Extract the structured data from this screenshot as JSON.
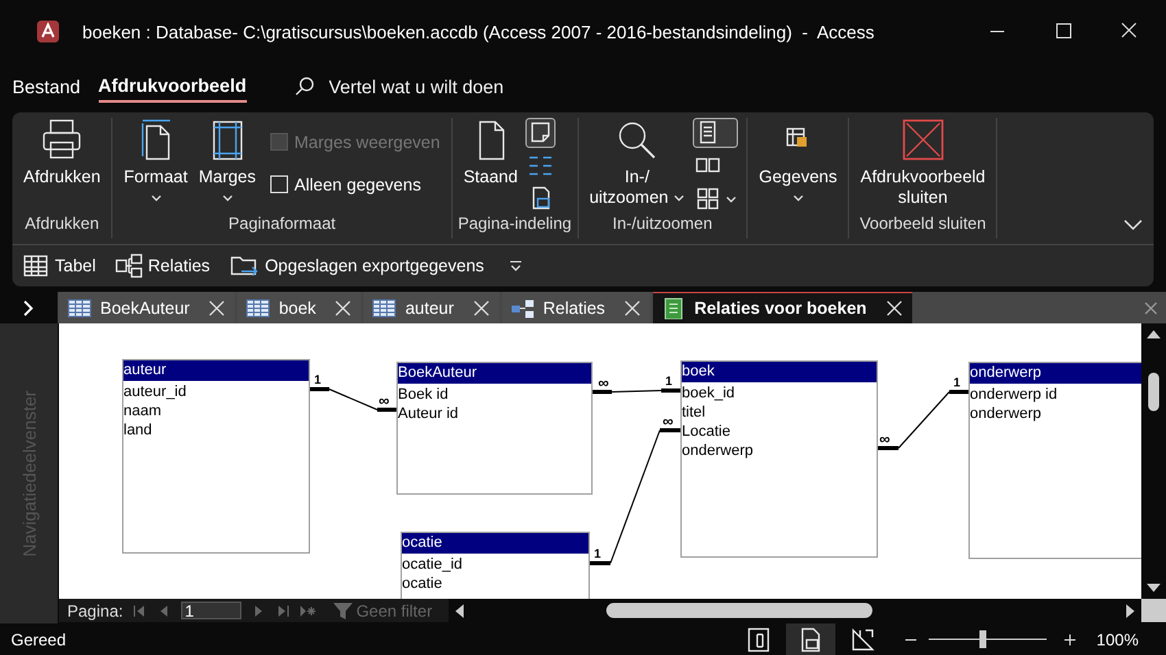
{
  "window": {
    "title": "boeken : Database- C:\\gratiscursus\\boeken.accdb (Access 2007 - 2016-bestandsindeling)  -  Access"
  },
  "menu": [
    {
      "label": "Bestand",
      "selected": false
    },
    {
      "label": "Afdrukvoorbeeld",
      "selected": true
    }
  ],
  "tell_me": {
    "placeholder": "Vertel wat u wilt doen"
  },
  "ribbon": {
    "groups": [
      {
        "label": "Afdrukken",
        "items": [
          {
            "kind": "large",
            "label": [
              "Afdrukken"
            ],
            "dropdown": false
          }
        ]
      },
      {
        "label": "Paginaformaat",
        "items": [
          {
            "kind": "large",
            "label": [
              "Formaat"
            ],
            "dropdown": true
          },
          {
            "kind": "large",
            "label": [
              "Marges"
            ],
            "dropdown": true
          },
          {
            "kind": "checkbox",
            "label": "Marges weergeven",
            "checked": false,
            "disabled": true
          },
          {
            "kind": "checkbox",
            "label": "Alleen gegevens",
            "checked": false,
            "disabled": false
          }
        ]
      },
      {
        "label": "Pagina-indeling",
        "items": [
          {
            "kind": "large",
            "label": [
              "Staand"
            ],
            "dropdown": false
          },
          {
            "kind": "icon",
            "selected": true,
            "dropdown": false
          },
          {
            "kind": "icon",
            "selected": false,
            "dropdown": false
          },
          {
            "kind": "icon",
            "selected": false,
            "dropdown": false
          }
        ]
      },
      {
        "label": "In-/uitzoomen",
        "items": [
          {
            "kind": "large",
            "label": [
              "In-/",
              "uitzoomen"
            ],
            "dropdown": true
          },
          {
            "kind": "icon",
            "selected": true,
            "dropdown": false
          },
          {
            "kind": "icon",
            "selected": false,
            "dropdown": false
          },
          {
            "kind": "icon",
            "selected": false,
            "dropdown": true
          }
        ]
      },
      {
        "items": [
          {
            "kind": "large",
            "label": [
              "Gegevens"
            ],
            "dropdown": true
          }
        ]
      },
      {
        "label": "Voorbeeld sluiten",
        "items": [
          {
            "kind": "large",
            "label": [
              "Afdrukvoorbeeld",
              "sluiten"
            ],
            "dropdown": false
          }
        ]
      }
    ]
  },
  "quick_access": [
    {
      "label": "Tabel"
    },
    {
      "label": "Relaties"
    },
    {
      "label": "Opgeslagen exportgegevens"
    }
  ],
  "tabs": [
    {
      "kind": "table",
      "label": "BoekAuteur",
      "selected": false
    },
    {
      "kind": "table",
      "label": "boek",
      "selected": false
    },
    {
      "kind": "table",
      "label": "auteur",
      "selected": false
    },
    {
      "kind": "relationships",
      "label": "Relaties",
      "selected": false
    },
    {
      "kind": "report",
      "label": "Relaties voor boeken",
      "selected": true
    }
  ],
  "navigation_pane": {
    "label": "Navigatiedeelvenster",
    "expanded": false
  },
  "diagram": {
    "tables": [
      {
        "title": "auteur",
        "fields": [
          "auteur_id",
          "naam",
          "land"
        ]
      },
      {
        "title": "BoekAuteur",
        "fields": [
          "Boek id",
          "Auteur id"
        ]
      },
      {
        "title": "boek",
        "fields": [
          "boek_id",
          "titel",
          "Locatie",
          "onderwerp"
        ]
      },
      {
        "title": "onderwerp",
        "fields": [
          "onderwerp id",
          "onderwerp"
        ]
      },
      {
        "title": "ocatie",
        "fields": [
          "ocatie_id",
          "ocatie"
        ]
      }
    ],
    "relationships": [
      {
        "one": "1",
        "many": "∞"
      },
      {
        "one": "1",
        "many": "∞"
      },
      {
        "one": "1",
        "many": "∞"
      },
      {
        "one": "1",
        "many": "∞"
      }
    ]
  },
  "record_navigator": {
    "label": "Pagina:",
    "value": "1",
    "filter": "Geen filter"
  },
  "status_bar": {
    "text": "Gereed",
    "views": [
      {
        "selected": false
      },
      {
        "selected": true
      },
      {
        "selected": false
      }
    ],
    "zoom": {
      "level": 0.45,
      "reading": "100%"
    }
  }
}
